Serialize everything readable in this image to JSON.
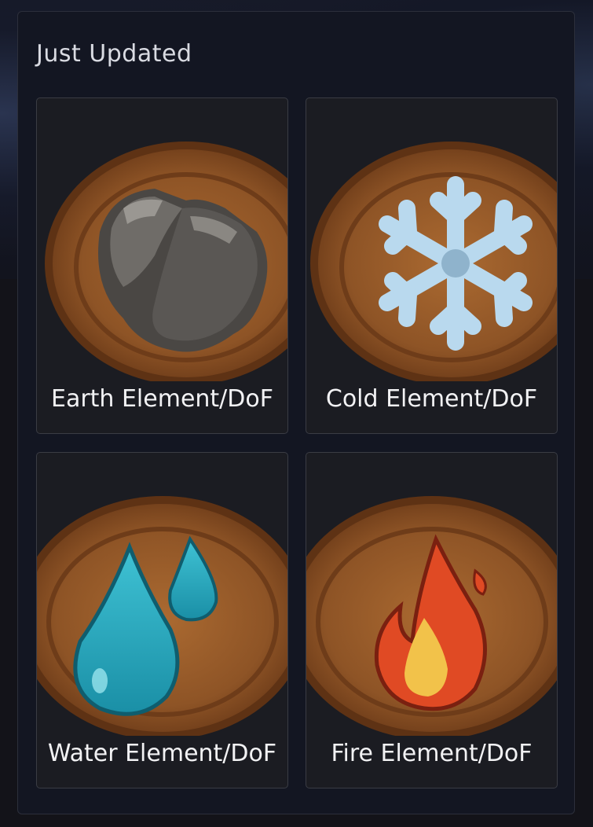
{
  "section": {
    "title": "Just Updated"
  },
  "cards": [
    {
      "label": "Earth Element/DoF",
      "icon": "earth-rock-icon"
    },
    {
      "label": "Cold Element/DoF",
      "icon": "snowflake-icon"
    },
    {
      "label": "Water Element/DoF",
      "icon": "water-drops-icon"
    },
    {
      "label": "Fire Element/DoF",
      "icon": "fire-icon"
    }
  ],
  "colors": {
    "panel_bg": "#131622",
    "card_bg": "#1b1c22",
    "wood": "#8a5226",
    "wood_light": "#b06e35",
    "text": "#f2f2f4"
  }
}
